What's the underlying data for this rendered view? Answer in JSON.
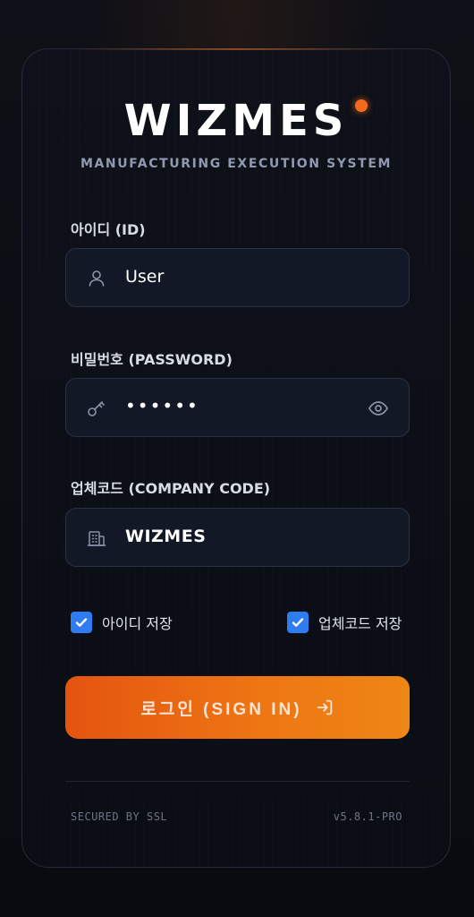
{
  "brand": {
    "logo_text": "WIZMES",
    "subtitle": "MANUFACTURING EXECUTION SYSTEM",
    "accent_color": "#f26a1b"
  },
  "form": {
    "id": {
      "label": "아이디 (ID)",
      "value": "User",
      "icon": "user-icon"
    },
    "password": {
      "label": "비밀번호 (PASSWORD)",
      "value": "••••••",
      "icon": "key-icon",
      "toggle_icon": "eye-icon"
    },
    "company_code": {
      "label": "업체코드 (COMPANY CODE)",
      "value": "WIZMES",
      "icon": "building-icon"
    }
  },
  "options": {
    "save_id": {
      "label": "아이디 저장",
      "checked": true
    },
    "save_company_code": {
      "label": "업체코드 저장",
      "checked": true
    }
  },
  "signin": {
    "label": "로그인 (SIGN IN)",
    "icon": "sign-in-arrow-icon"
  },
  "footer": {
    "security": "SECURED BY SSL",
    "version": "v5.8.1-PRO"
  }
}
